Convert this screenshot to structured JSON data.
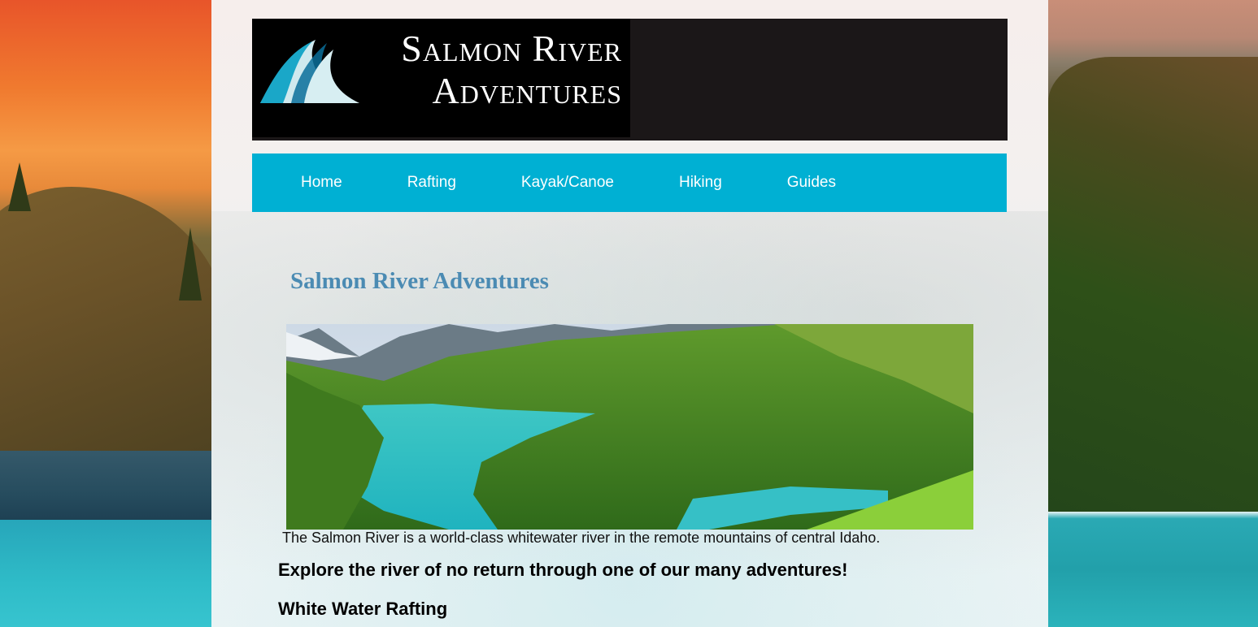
{
  "logo": {
    "line1": "Salmon River",
    "line2": "Adventures"
  },
  "nav": {
    "items": [
      "Home",
      "Rafting",
      "Kayak/Canoe",
      "Hiking",
      "Guides"
    ]
  },
  "main": {
    "title": "Salmon River Adventures",
    "caption": "The Salmon River is a world-class whitewater river in the remote mountains of central Idaho.",
    "tagline": "Explore the river of no return through one of our many adventures!",
    "section_heading": "White Water Rafting"
  },
  "colors": {
    "nav_bg": "#00b0d3",
    "title": "#4b8bb3",
    "header_bg": "#1b1718"
  }
}
